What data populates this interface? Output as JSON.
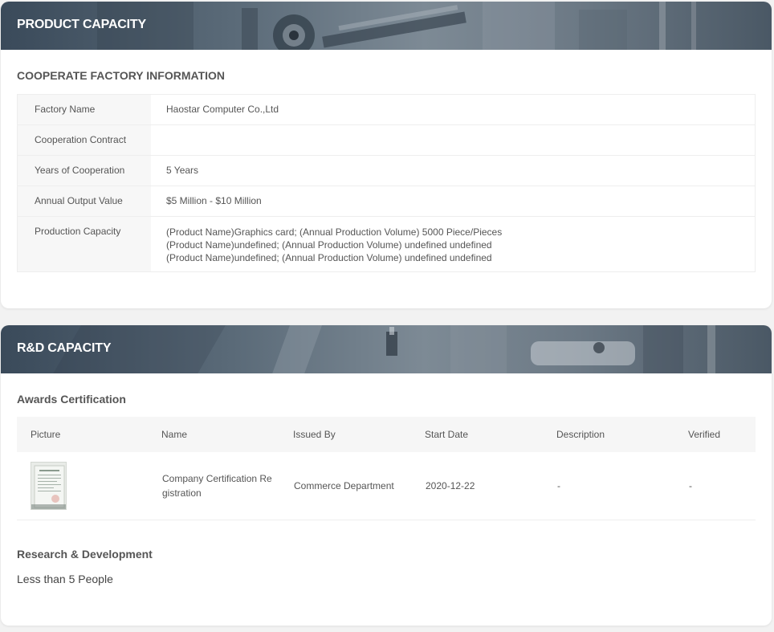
{
  "product": {
    "title": "PRODUCT CAPACITY",
    "factory_section_title": "COOPERATE FACTORY INFORMATION",
    "rows": [
      {
        "label": "Factory Name",
        "value": "Haostar Computer Co.,Ltd"
      },
      {
        "label": "Cooperation Contract",
        "value": ""
      },
      {
        "label": "Years of Cooperation",
        "value": "5 Years"
      },
      {
        "label": "Annual Output Value",
        "value": "$5 Million - $10 Million"
      }
    ],
    "capacity": {
      "label": "Production Capacity",
      "lines": [
        "(Product Name)Graphics card; (Annual Production Volume) 5000 Piece/Pieces",
        "(Product Name)undefined; (Annual Production Volume) undefined undefined",
        "(Product Name)undefined; (Annual Production Volume) undefined undefined"
      ]
    }
  },
  "rd": {
    "title": "R&D CAPACITY",
    "awards_title": "Awards Certification",
    "columns": [
      "Picture",
      "Name",
      "Issued By",
      "Start Date",
      "Description",
      "Verified"
    ],
    "awards": [
      {
        "picture_icon": "certificate-thumbnail",
        "name": "Company Certification Registration",
        "issued_by": "Commerce Department",
        "start_date": "2020-12-22",
        "description": "-",
        "verified": "-"
      }
    ],
    "research_title": "Research & Development",
    "research_value": "Less than 5 People"
  },
  "colors": {
    "banner_dark": "#3a4a5a",
    "banner_light": "#7d8a95",
    "label_bg": "#f7f7f7",
    "page_bg": "#f2f2f2"
  }
}
